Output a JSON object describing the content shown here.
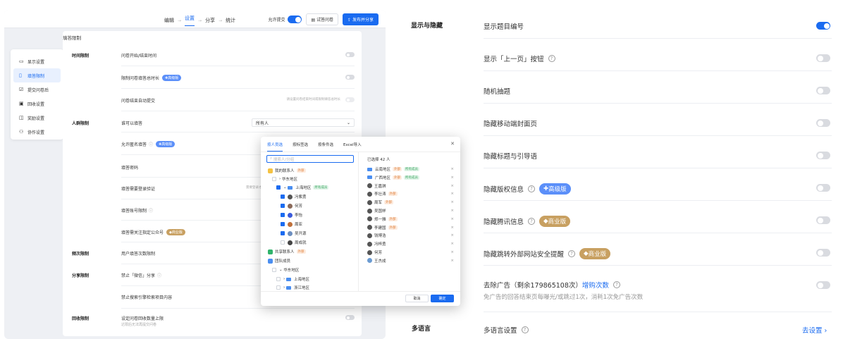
{
  "left_panel": {
    "steps": [
      "编辑",
      "设置",
      "分享",
      "统计"
    ],
    "allow_submit_label": "允许提交",
    "preview_label": "试答问卷",
    "publish_label": "发布并分享",
    "card_header": "填答限制",
    "sidebar": [
      "显示设置",
      "填答限制",
      "提交问卷后",
      "回收设置",
      "奖励设置",
      "协作设置"
    ],
    "sections": {
      "time": "时间限制",
      "crowd": "人群限制",
      "frequency": "频次限制",
      "share": "分享限制",
      "recycle": "回收限制"
    },
    "rows": {
      "start_end": "问卷开始/结束时间",
      "limit_duration": "限制问卷填答总时长",
      "auto_submit": "问卷结束自动提交",
      "auto_submit_hint": "请设置问卷结束时间或限制填答总时长",
      "who_can": "谁可以填答",
      "who_can_value": "所有人",
      "allow_named": "允许匿名填答",
      "need_password": "填答密码",
      "need_login": "填答需要登录验证",
      "need_login_hint": "需要登录才",
      "account_limit": "填答账号限制",
      "follow_official": "填答需关注指定公众号",
      "user_times": "用户填答次数限制",
      "forbid_wechat": "禁止「微信」分享",
      "forbid_search": "禁止搜索引擎检索项目内容",
      "recycle_limit": "设定问卷回收数量上限",
      "recycle_limit_hint": "达限后无法再提交问卷"
    },
    "badges": {
      "advanced": "高级版",
      "business": "商业版"
    }
  },
  "modal": {
    "tabs": [
      "按人员选",
      "按标签选",
      "按条件选",
      "Excel导入"
    ],
    "search_placeholder": "搜索人/分组",
    "selected_header": "已选择 42 人",
    "tree": {
      "my_contacts": "我的联系人",
      "my_contacts_tag": "外部",
      "east_china": "华东地区",
      "shanghai": "上海地区",
      "shanghai_tag": "所有成员",
      "people": [
        "冯紫勇",
        "何芳",
        "李怡",
        "周亚",
        "吴开源",
        "周成就"
      ],
      "contacts_shared": "共享联系人",
      "contacts_shared_tag": "外部",
      "team": "团队成员",
      "team_east": "华东地区",
      "team_shanghai": "上海地区",
      "team_zhejiang": "浙江地区"
    },
    "selected": [
      {
        "name": "云南地区",
        "tags": [
          "外部",
          "所有成员"
        ]
      },
      {
        "name": "广西地区",
        "tags": [
          "外部",
          "所有成员"
        ]
      },
      {
        "name": "王嘉琪",
        "tags": []
      },
      {
        "name": "李壮涛",
        "tags": [
          "外部"
        ]
      },
      {
        "name": "周军",
        "tags": [
          "外部"
        ]
      },
      {
        "name": "吴国祥",
        "tags": []
      },
      {
        "name": "郑一雅",
        "tags": [
          "外部"
        ]
      },
      {
        "name": "李建国",
        "tags": [
          "外部"
        ]
      },
      {
        "name": "钱博浩",
        "tags": []
      },
      {
        "name": "冯梓勇",
        "tags": []
      },
      {
        "name": "何芳",
        "tags": []
      },
      {
        "name": "王杰成",
        "tags": []
      }
    ],
    "cancel_label": "取消",
    "ok_label": "确定"
  },
  "right_panel": {
    "section_show_hide": "显示与隐藏",
    "section_multilang": "多语言",
    "items": [
      {
        "label": "显示题目编号",
        "on": true
      },
      {
        "label": "显示「上一页」按钮",
        "help": true,
        "on": false
      },
      {
        "label": "随机抽题",
        "on": false
      },
      {
        "label": "隐藏移动端封面页",
        "on": false
      },
      {
        "label": "隐藏标题与引导语",
        "on": false
      },
      {
        "label": "隐藏版权信息",
        "help": true,
        "badge": "高级版",
        "on": false
      },
      {
        "label": "隐藏腾讯信息",
        "help": true,
        "badge": "商业版",
        "on": false
      },
      {
        "label": "隐藏跳转外部网站安全提醒",
        "help": true,
        "badge": "商业版",
        "on": false
      }
    ],
    "remove_ads": {
      "label": "去除广告（剩余179865108次）",
      "buy_link": "增购次数",
      "desc": "免广告的回答结束页每曝光/或跳过1次，消耗1次免广告次数"
    },
    "multilang": {
      "label": "多语言设置",
      "link": "去设置"
    },
    "colors": {
      "accent": "#1a6bf0",
      "advanced": "#5b8ff9",
      "business": "#c8a061"
    }
  }
}
